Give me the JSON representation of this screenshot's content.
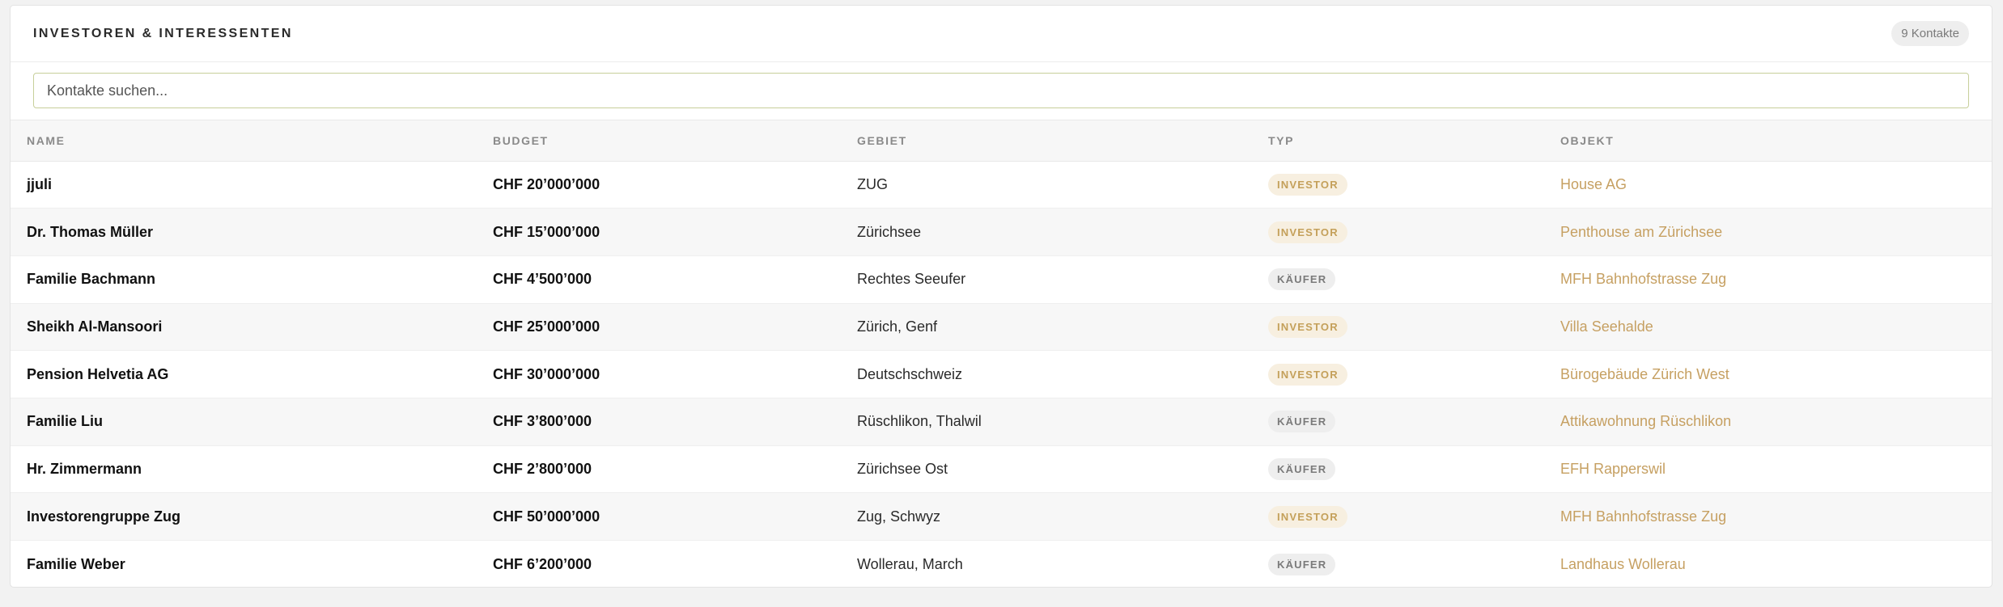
{
  "header": {
    "title": "INVESTOREN & INTERESSENTEN",
    "count_badge": "9 Kontakte"
  },
  "search": {
    "placeholder": "Kontakte suchen...",
    "value": ""
  },
  "table": {
    "columns": [
      "NAME",
      "BUDGET",
      "GEBIET",
      "TYP",
      "OBJEKT"
    ],
    "rows": [
      {
        "name": "jjuli",
        "budget": "CHF 20’000’000",
        "gebiet": "ZUG",
        "typ": "INVESTOR",
        "typ_kind": "investor",
        "objekt": "House AG"
      },
      {
        "name": "Dr. Thomas Müller",
        "budget": "CHF 15’000’000",
        "gebiet": "Zürichsee",
        "typ": "INVESTOR",
        "typ_kind": "investor",
        "objekt": "Penthouse am Zürichsee"
      },
      {
        "name": "Familie Bachmann",
        "budget": "CHF 4’500’000",
        "gebiet": "Rechtes Seeufer",
        "typ": "KÄUFER",
        "typ_kind": "kaeufer",
        "objekt": "MFH Bahnhofstrasse Zug"
      },
      {
        "name": "Sheikh Al-Mansoori",
        "budget": "CHF 25’000’000",
        "gebiet": "Zürich, Genf",
        "typ": "INVESTOR",
        "typ_kind": "investor",
        "objekt": "Villa Seehalde"
      },
      {
        "name": "Pension Helvetia AG",
        "budget": "CHF 30’000’000",
        "gebiet": "Deutschschweiz",
        "typ": "INVESTOR",
        "typ_kind": "investor",
        "objekt": "Bürogebäude Zürich West"
      },
      {
        "name": "Familie Liu",
        "budget": "CHF 3’800’000",
        "gebiet": "Rüschlikon, Thalwil",
        "typ": "KÄUFER",
        "typ_kind": "kaeufer",
        "objekt": "Attikawohnung Rüschlikon"
      },
      {
        "name": "Hr. Zimmermann",
        "budget": "CHF 2’800’000",
        "gebiet": "Zürichsee Ost",
        "typ": "KÄUFER",
        "typ_kind": "kaeufer",
        "objekt": "EFH Rapperswil"
      },
      {
        "name": "Investorengruppe Zug",
        "budget": "CHF 50’000’000",
        "gebiet": "Zug, Schwyz",
        "typ": "INVESTOR",
        "typ_kind": "investor",
        "objekt": "MFH Bahnhofstrasse Zug"
      },
      {
        "name": "Familie Weber",
        "budget": "CHF 6’200’000",
        "gebiet": "Wollerau, March",
        "typ": "KÄUFER",
        "typ_kind": "kaeufer",
        "objekt": "Landhaus Wollerau"
      }
    ]
  }
}
